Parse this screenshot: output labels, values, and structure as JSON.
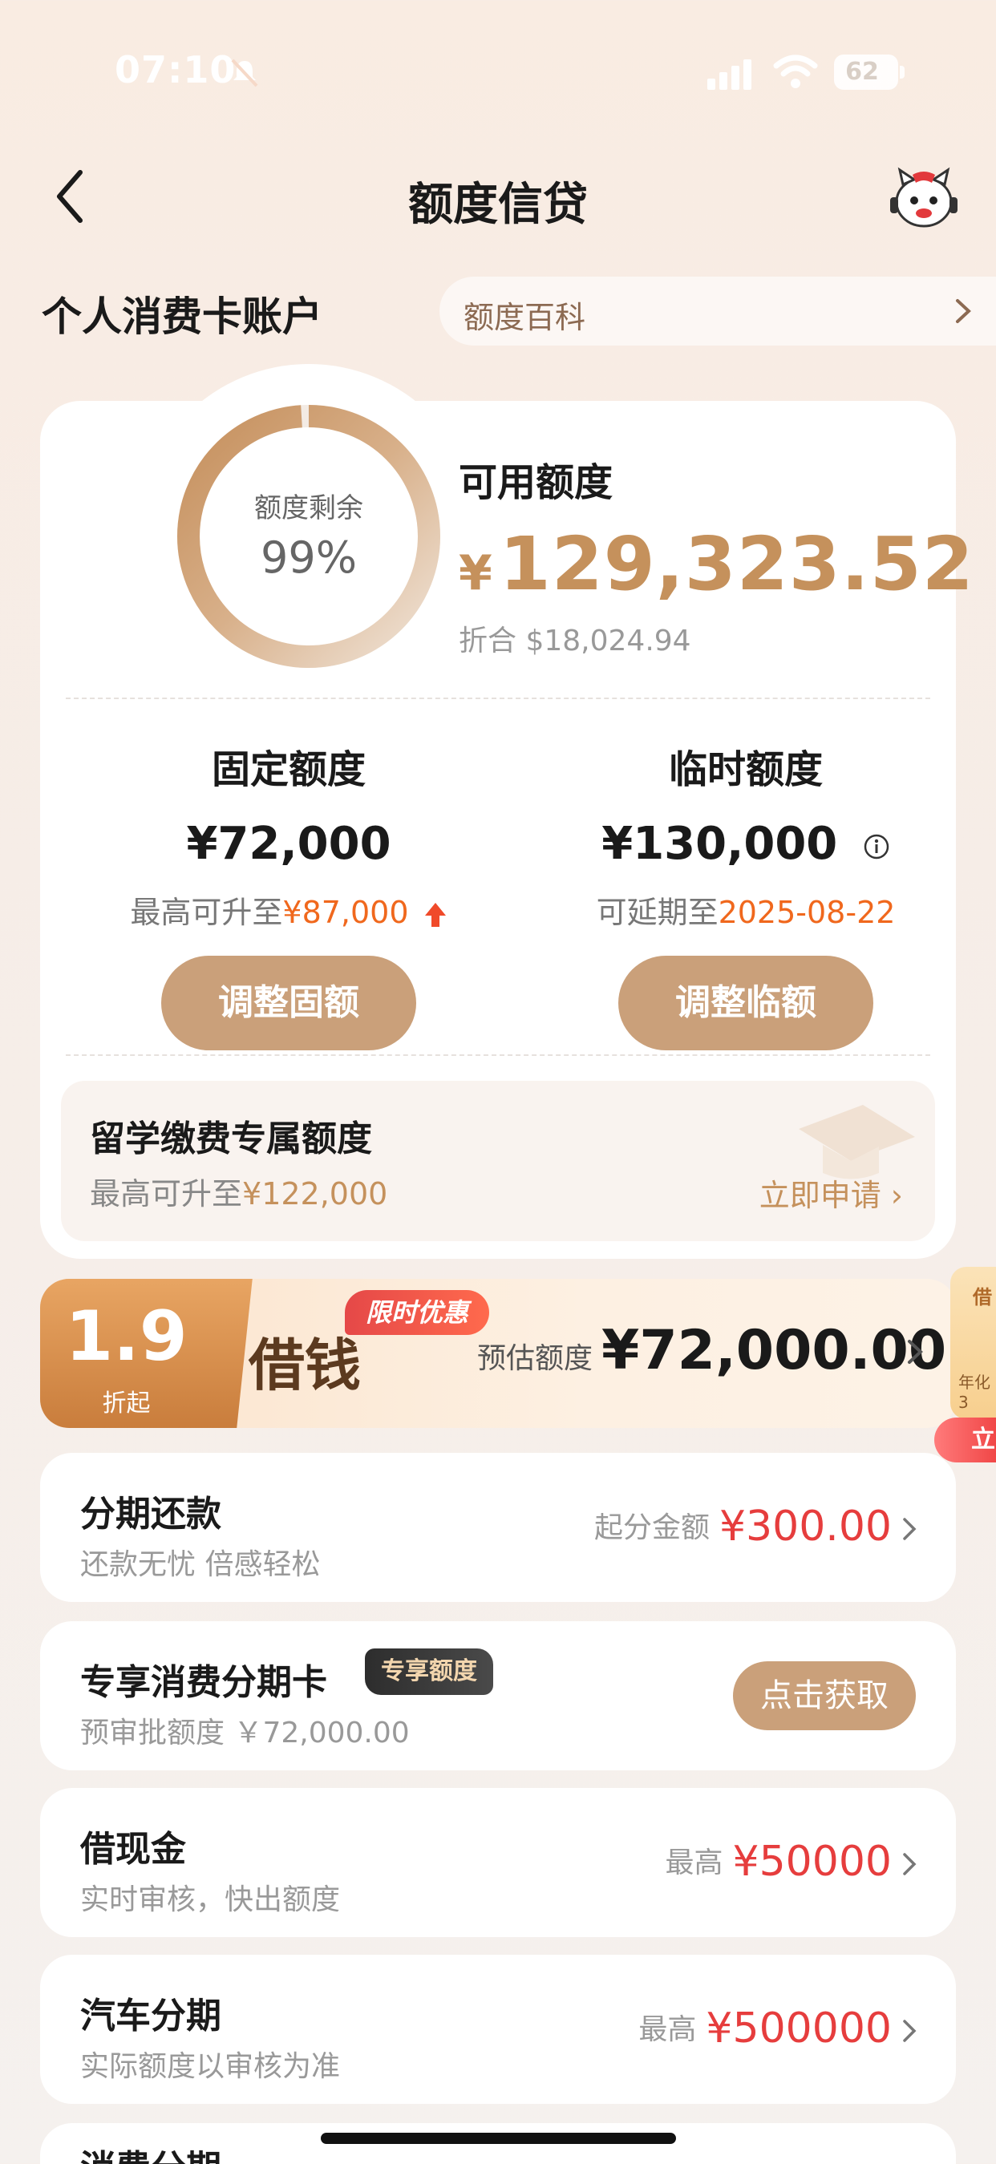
{
  "status": {
    "time": "07:10",
    "battery": "62"
  },
  "nav": {
    "title": "额度信贷"
  },
  "account": {
    "section_title": "个人消费卡账户",
    "search_text": "额度百科"
  },
  "summary": {
    "ring_label": "额度剩余",
    "ring_value": "99%",
    "ring_fraction": 0.99,
    "available_label": "可用额度",
    "currency": "¥",
    "available_amount": "129,323.52",
    "converted": "折合  $18,024.94"
  },
  "fixed": {
    "title": "固定额度",
    "amount": "¥72,000",
    "note_prefix": "最高可升至",
    "note_value": "¥87,000",
    "button": "调整固额"
  },
  "temp": {
    "title": "临时额度",
    "amount": "¥130,000",
    "note_prefix": "可延期至",
    "note_value": "2025-08-22",
    "button": "调整临额"
  },
  "study": {
    "title": "留学缴费专属额度",
    "note_prefix": "最高可升至",
    "note_value": "¥122,000",
    "link": "立即申请 ›"
  },
  "loan": {
    "discount": "1.9",
    "discount_sub": "折起",
    "title": "借钱",
    "promo": "限时优惠",
    "est_label": "预估额度",
    "est_amount": "¥72,000.00"
  },
  "side_peek": {
    "top": "借",
    "mid": "年化3",
    "button": "立"
  },
  "items": [
    {
      "title": "分期还款",
      "sub": "还款无忧 倍感轻松",
      "right_label": "起分金额",
      "right_value": "¥300.00"
    },
    {
      "title": "专享消费分期卡",
      "tag": "专享额度",
      "sub": "预审批额度 ￥72,000.00",
      "button": "点击获取"
    },
    {
      "title": "借现金",
      "sub": "实时审核，快出额度",
      "right_label": "最高",
      "right_value": "¥50000"
    },
    {
      "title": "汽车分期",
      "sub": "实际额度以审核为准",
      "right_label": "最高",
      "right_value": "¥500000"
    },
    {
      "title": "消费分期"
    }
  ],
  "colors": {
    "accent": "#c5915c",
    "button": "#caa07a",
    "highlight": "#f0681d",
    "red": "#e63d3d"
  }
}
